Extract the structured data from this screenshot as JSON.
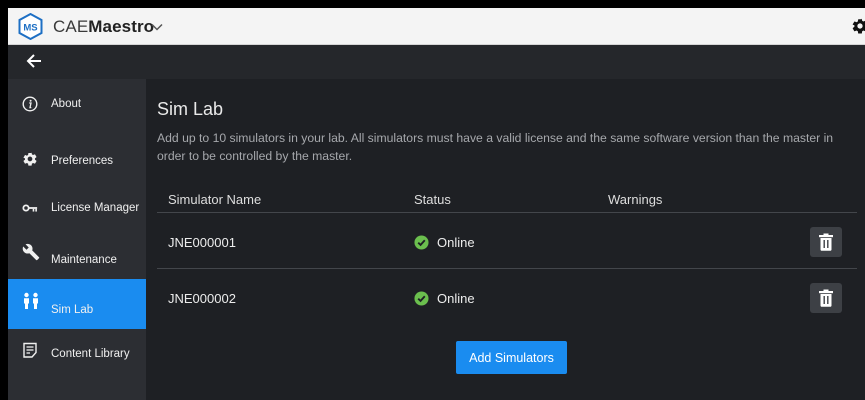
{
  "app": {
    "logo_text": "MS",
    "title_prefix": "CAE",
    "title_bold": "Maestro"
  },
  "icons": {
    "logo": "ms-hexagon-logo",
    "menu": "chevron-down-icon",
    "settings": "gear-icon",
    "back": "arrow-left-icon",
    "delete": "trash-icon",
    "status_ok": "check-circle-icon"
  },
  "colors": {
    "accent": "#1a8cf0",
    "online": "#6bbf4e",
    "background": "#1e2024",
    "sidebar": "#2c2e33"
  },
  "sidebar": {
    "items": [
      {
        "label": "About",
        "icon": "info-icon",
        "active": false
      },
      {
        "label": "Preferences",
        "icon": "gear-icon",
        "active": false
      },
      {
        "label": "License Manager",
        "icon": "key-icon",
        "active": false
      },
      {
        "label": "Maintenance",
        "icon": "wrench-icon",
        "active": false
      },
      {
        "label": "Sim Lab",
        "icon": "people-icon",
        "active": true
      },
      {
        "label": "Content Library",
        "icon": "document-icon",
        "active": false
      }
    ]
  },
  "main": {
    "title": "Sim Lab",
    "description": "Add up to 10 simulators in your lab. All simulators must have a valid license and the same software version than the master in order to be controlled by the master.",
    "table": {
      "columns": [
        "Simulator Name",
        "Status",
        "Warnings"
      ],
      "rows": [
        {
          "name": "JNE000001",
          "status": "Online",
          "warnings": ""
        },
        {
          "name": "JNE000002",
          "status": "Online",
          "warnings": ""
        }
      ]
    },
    "add_button": "Add Simulators"
  }
}
